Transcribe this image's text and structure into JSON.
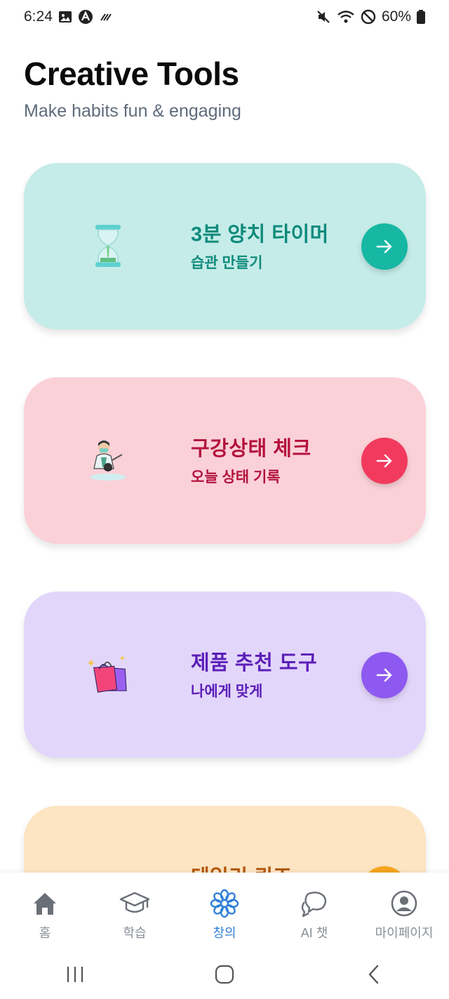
{
  "status_bar": {
    "time": "6:24",
    "battery": "60%",
    "left_icons": [
      "image-icon",
      "app-a-icon",
      "signal-lines-icon"
    ],
    "right_icons": [
      "mute-icon",
      "wifi-icon",
      "no-disturb-icon",
      "battery-icon"
    ]
  },
  "header": {
    "title": "Creative Tools",
    "subtitle": "Make habits fun & engaging"
  },
  "cards": [
    {
      "title": "3분 양치 타이머",
      "subtitle": "습관 만들기",
      "icon": "hourglass-icon",
      "bg": "#c5ece8",
      "text_color": "#0f8a7c",
      "accent": "#16b7a3"
    },
    {
      "title": "구강상태 체크",
      "subtitle": "오늘 상태 기록",
      "icon": "dentist-icon",
      "bg": "#fbd1d8",
      "text_color": "#b3123f",
      "accent": "#f23a5e"
    },
    {
      "title": "제품 추천 도구",
      "subtitle": "나에게 맞게",
      "icon": "shopping-bags-icon",
      "bg": "#e3d6fb",
      "text_color": "#5b1fb8",
      "accent": "#8e59f0"
    },
    {
      "title": "데일리 퀴즈",
      "subtitle": "",
      "icon": "quiz-icon",
      "bg": "#fde4c2",
      "text_color": "#b3590b",
      "accent": "#f5a51c"
    }
  ],
  "bottom_nav": {
    "items": [
      {
        "label": "홈",
        "icon": "home-icon"
      },
      {
        "label": "학습",
        "icon": "graduation-cap-icon"
      },
      {
        "label": "창의",
        "icon": "flower-icon",
        "active": true
      },
      {
        "label": "AI 챗",
        "icon": "chat-bubbles-icon"
      },
      {
        "label": "마이페이지",
        "icon": "user-circle-icon"
      }
    ]
  },
  "colors": {
    "active_nav": "#2f7fd6",
    "inactive_nav": "#8a8f97"
  }
}
